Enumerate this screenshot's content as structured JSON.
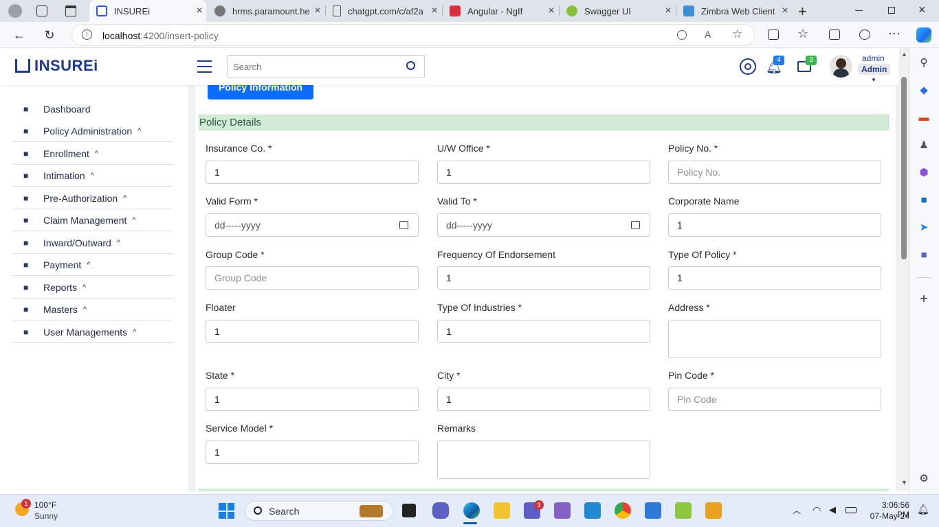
{
  "browser": {
    "tabs": [
      {
        "title": "INSUREi",
        "active": true
      },
      {
        "title": "hrms.paramount.he"
      },
      {
        "title": "chatgpt.com/c/af2a"
      },
      {
        "title": "Angular - NgIf"
      },
      {
        "title": "Swagger UI"
      },
      {
        "title": "Zimbra Web Client"
      }
    ],
    "url_host": "localhost",
    "url_path": ":4200/insert-policy"
  },
  "header": {
    "brand": "INSUREi",
    "search_placeholder": "Search",
    "notif_count": "4",
    "msg_count": "3",
    "user_name": "admin",
    "user_role": "Admin"
  },
  "sidebar": {
    "items": [
      {
        "label": "Dashboard",
        "icon": "home-icon",
        "chev": ""
      },
      {
        "label": "Policy Administration",
        "icon": "policy-icon",
        "chev": "^"
      },
      {
        "label": "Enrollment",
        "icon": "user-plus-icon",
        "chev": "^"
      },
      {
        "label": "Intimation",
        "icon": "intimation-icon",
        "chev": "^"
      },
      {
        "label": "Pre-Authorization",
        "icon": "shield-icon",
        "chev": "^"
      },
      {
        "label": "Claim Management",
        "icon": "claim-icon",
        "chev": "^"
      },
      {
        "label": "Inward/Outward",
        "icon": "inout-icon",
        "chev": "^"
      },
      {
        "label": "Payment",
        "icon": "payment-icon",
        "chev": "^"
      },
      {
        "label": "Reports",
        "icon": "reports-icon",
        "chev": "^"
      },
      {
        "label": "Masters",
        "icon": "masters-icon",
        "chev": "^"
      },
      {
        "label": "User Managements",
        "icon": "users-icon",
        "chev": "^"
      }
    ]
  },
  "main": {
    "top_button": "Policy Information",
    "section_title": "Policy Details",
    "fields": {
      "insurance_co": {
        "label": "Insurance Co. *",
        "value": "1"
      },
      "uw_office": {
        "label": "U/W Office *",
        "value": "1"
      },
      "policy_no": {
        "label": "Policy No. *",
        "placeholder": "Policy No."
      },
      "valid_from": {
        "label": "Valid Form *",
        "placeholder": "dd-----yyyy"
      },
      "valid_to": {
        "label": "Valid To *",
        "placeholder": "dd-----yyyy"
      },
      "corporate_name": {
        "label": "Corporate Name",
        "value": "1"
      },
      "group_code": {
        "label": "Group Code *",
        "placeholder": "Group Code"
      },
      "freq_endorsement": {
        "label": "Frequency Of Endorsement",
        "value": "1"
      },
      "type_of_policy": {
        "label": "Type Of Policy *",
        "value": "1"
      },
      "floater": {
        "label": "Floater",
        "value": "1"
      },
      "type_of_industries": {
        "label": "Type Of Industries *",
        "value": "1"
      },
      "address": {
        "label": "Address *",
        "value": ""
      },
      "state": {
        "label": "State *",
        "value": "1"
      },
      "city": {
        "label": "City *",
        "value": "1"
      },
      "pin_code": {
        "label": "Pin Code *",
        "placeholder": "Pin Code"
      },
      "service_model": {
        "label": "Service Model *",
        "value": "1"
      },
      "remarks": {
        "label": "Remarks",
        "value": ""
      }
    }
  },
  "taskbar": {
    "weather_temp": "100°F",
    "weather_desc": "Sunny",
    "weather_badge": "1",
    "search_label": "Search",
    "teams_badge": "3",
    "time": "3:06:56 PM",
    "date": "07-May-24"
  },
  "colors": {
    "brand": "#1d3a8a",
    "primary": "#0d6efd",
    "section_bg": "#d3ecd7"
  }
}
